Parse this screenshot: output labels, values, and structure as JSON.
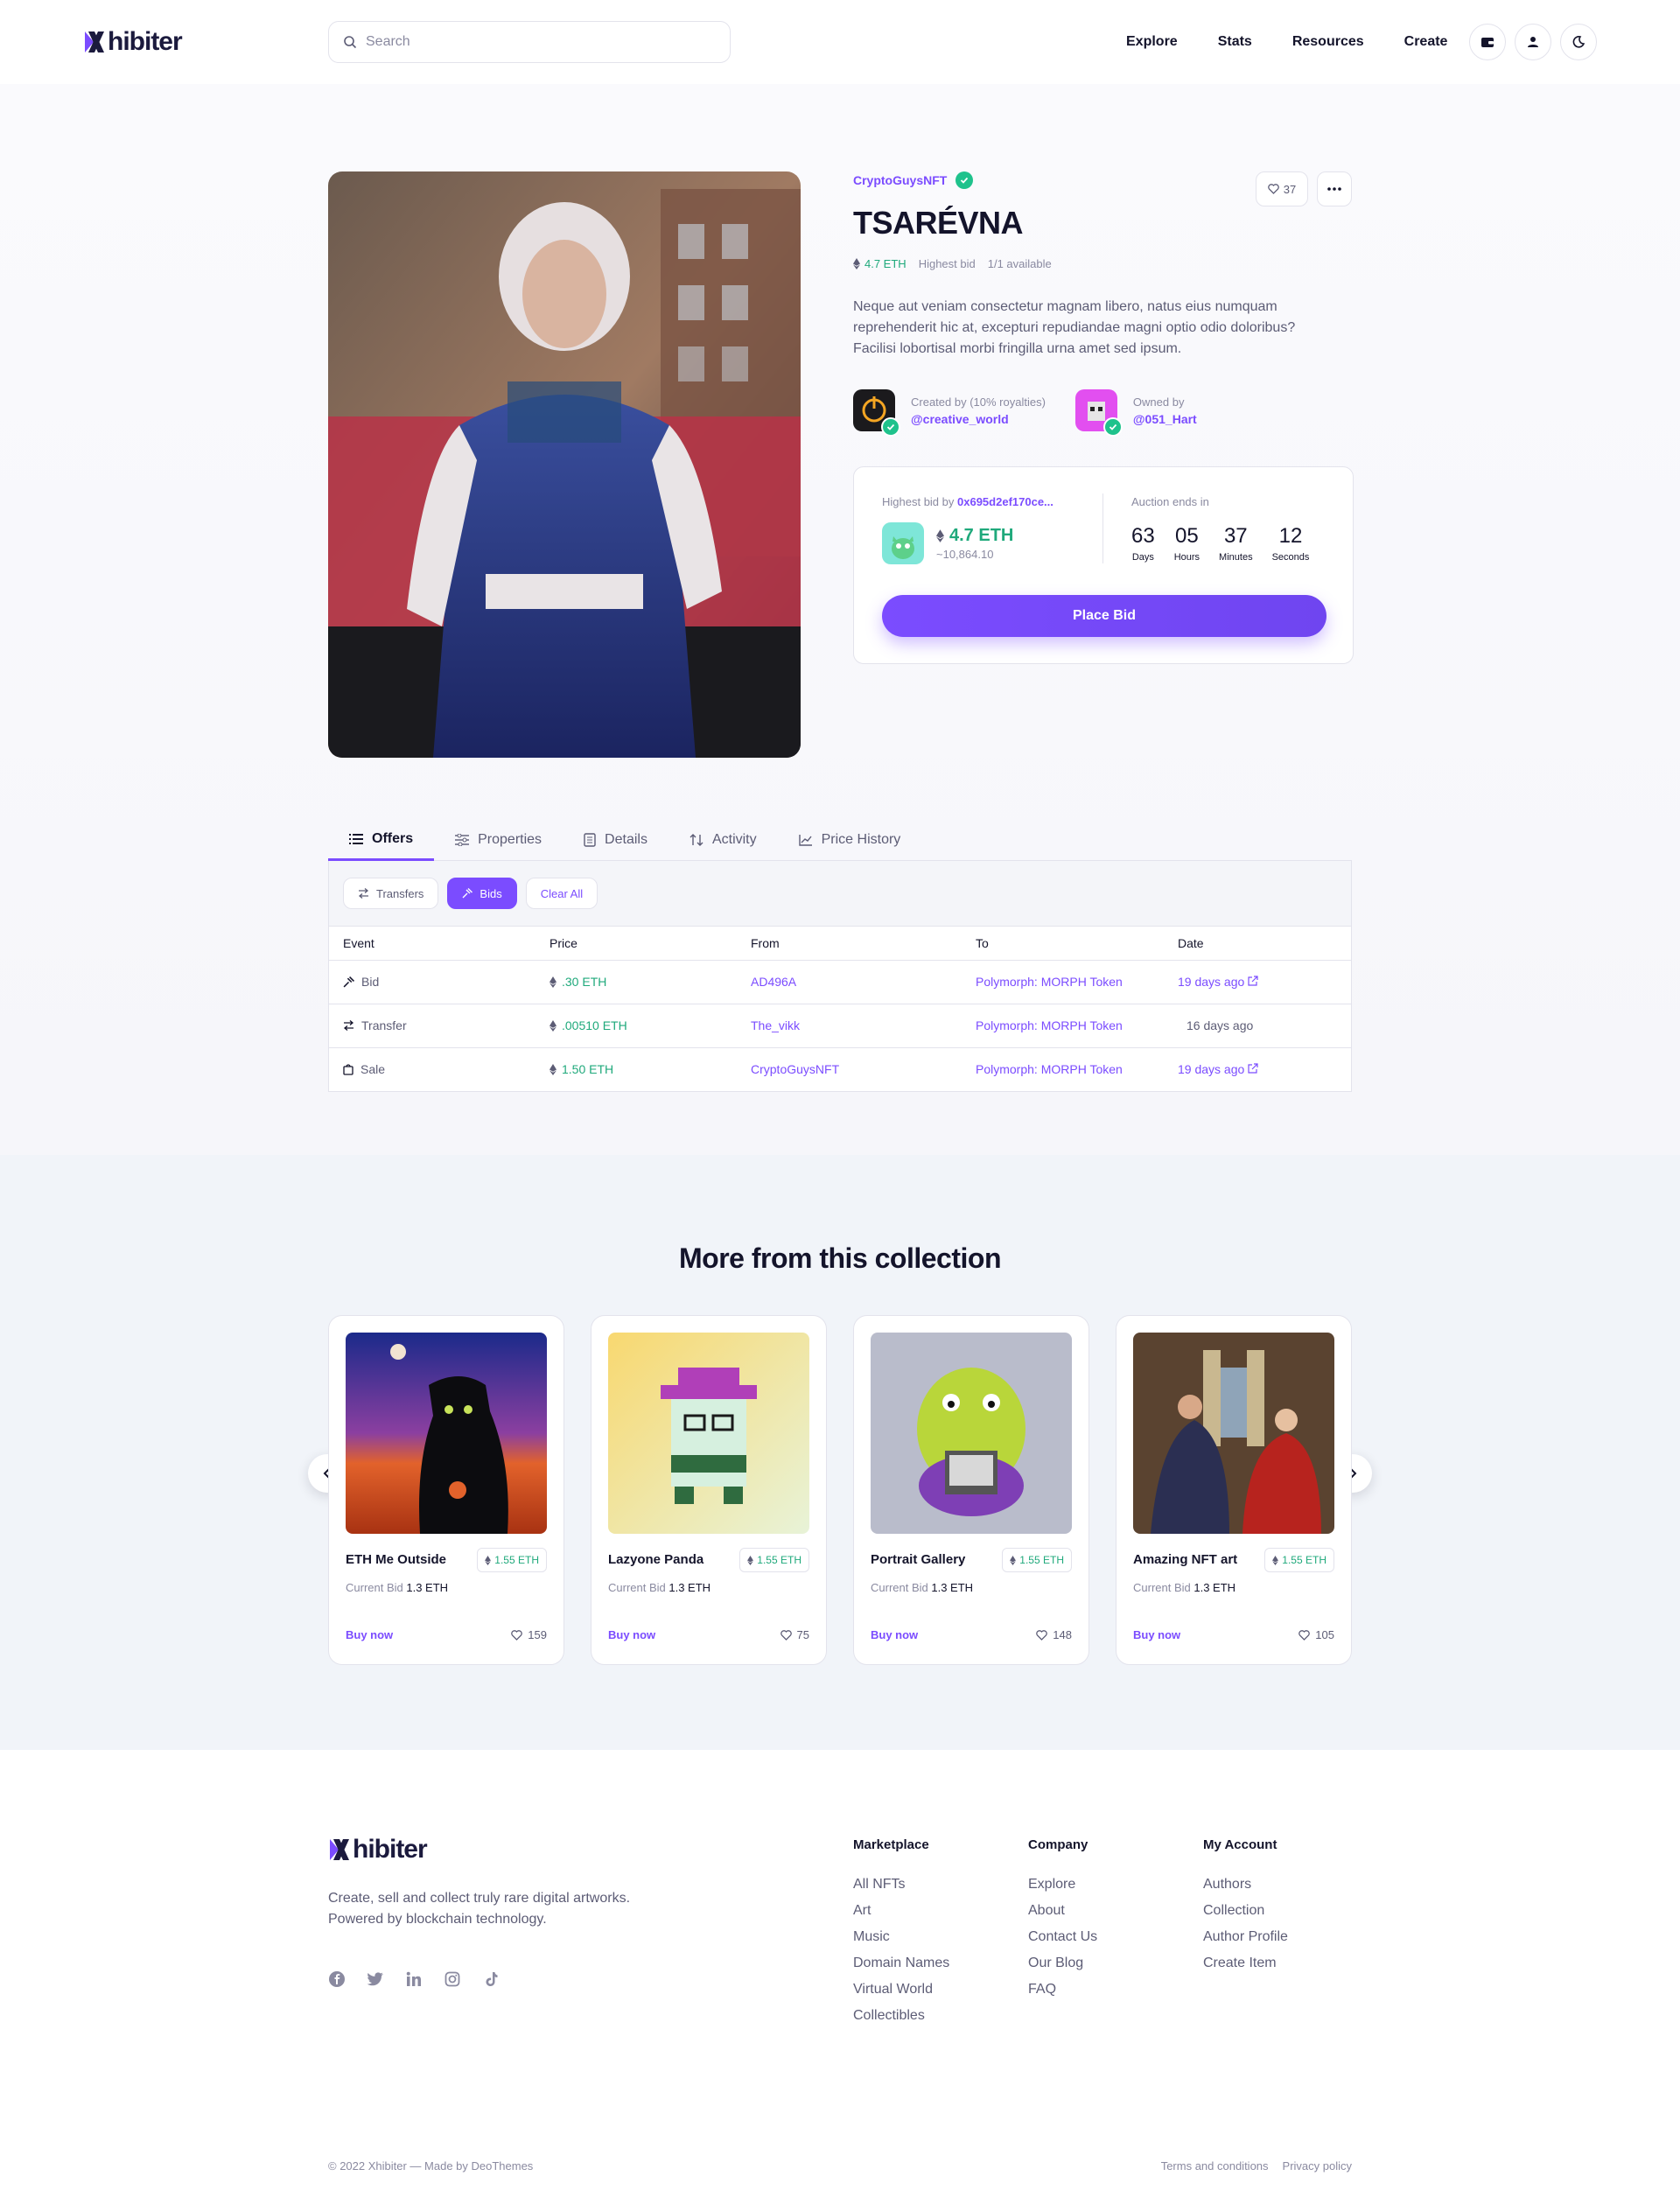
{
  "brand": {
    "name": "Xhibiter",
    "accent": "#7b4cff",
    "eth_green": "#1fa97b"
  },
  "header": {
    "search_placeholder": "Search",
    "nav": [
      "Explore",
      "Stats",
      "Resources",
      "Create"
    ],
    "icons": [
      "wallet-icon",
      "user-icon",
      "moon-icon"
    ]
  },
  "item": {
    "collection": "CryptoGuysNFT",
    "title": "TSARÉVNA",
    "eth": "4.7 ETH",
    "highest_bid_label": "Highest bid",
    "availability": "1/1 available",
    "likes": "37",
    "description": "Neque aut veniam consectetur magnam libero, natus eius numquam reprehenderit hic at, excepturi repudiandae magni optio odio doloribus? Facilisi lobortisal morbi fringilla urna amet sed ipsum.",
    "creator_label": "Created by (10% royalties)",
    "creator_handle": "@creative_world",
    "owner_label": "Owned by",
    "owner_handle": "@051_Hart"
  },
  "bid": {
    "highest_by_label": "Highest bid by",
    "highest_by_addr": "0x695d2ef170ce...",
    "eth": "4.7 ETH",
    "usd": "~10,864.10",
    "auction_label": "Auction ends in",
    "countdown": [
      {
        "value": "63",
        "unit": "Days"
      },
      {
        "value": "05",
        "unit": "Hours"
      },
      {
        "value": "37",
        "unit": "Minutes"
      },
      {
        "value": "12",
        "unit": "Seconds"
      }
    ],
    "cta": "Place Bid"
  },
  "tabs": [
    "Offers",
    "Properties",
    "Details",
    "Activity",
    "Price History"
  ],
  "filters": [
    "Transfers",
    "Bids",
    "Clear All"
  ],
  "table": {
    "headers": [
      "Event",
      "Price",
      "From",
      "To",
      "Date"
    ],
    "rows": [
      {
        "event": "Bid",
        "price": ".30 ETH",
        "from": "AD496A",
        "to": "Polymorph: MORPH Token",
        "date": "19 days ago"
      },
      {
        "event": "Transfer",
        "price": ".00510 ETH",
        "from": "The_vikk",
        "to": "Polymorph: MORPH Token",
        "date": "16 days ago"
      },
      {
        "event": "Sale",
        "price": "1.50 ETH",
        "from": "CryptoGuysNFT",
        "to": "Polymorph: MORPH Token",
        "date": "19 days ago"
      }
    ]
  },
  "more": {
    "heading": "More from this collection",
    "current_bid_label": "Current Bid",
    "buy_label": "Buy now",
    "cards": [
      {
        "name": "ETH Me Outside",
        "price": "1.55 ETH",
        "bid": "1.3 ETH",
        "likes": "159"
      },
      {
        "name": "Lazyone Panda",
        "price": "1.55 ETH",
        "bid": "1.3 ETH",
        "likes": "75"
      },
      {
        "name": "Portrait Gallery",
        "price": "1.55 ETH",
        "bid": "1.3 ETH",
        "likes": "148"
      },
      {
        "name": "Amazing NFT art",
        "price": "1.55 ETH",
        "bid": "1.3 ETH",
        "likes": "105"
      }
    ]
  },
  "footer": {
    "tagline": "Create, sell and collect truly rare digital artworks. Powered by blockchain technology.",
    "columns": [
      {
        "title": "Marketplace",
        "links": [
          "All NFTs",
          "Art",
          "Music",
          "Domain Names",
          "Virtual World",
          "Collectibles"
        ]
      },
      {
        "title": "Company",
        "links": [
          "Explore",
          "About",
          "Contact Us",
          "Our Blog",
          "FAQ"
        ]
      },
      {
        "title": "My Account",
        "links": [
          "Authors",
          "Collection",
          "Author Profile",
          "Create Item"
        ]
      }
    ],
    "copyright": "© 2022 Xhibiter — Made by DeoThemes",
    "legal": [
      "Terms and conditions",
      "Privacy policy"
    ]
  }
}
